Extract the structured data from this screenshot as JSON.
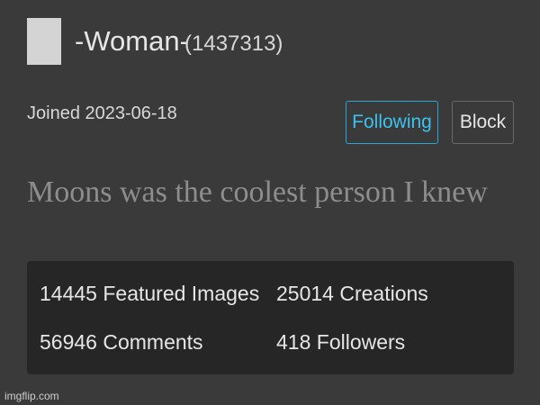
{
  "profile": {
    "username": "-Woman-",
    "user_id": "(1437313)",
    "joined": "Joined 2023-06-18",
    "bio": "Moons was the coolest person I knew"
  },
  "actions": {
    "following_label": "Following",
    "block_label": "Block"
  },
  "stats": {
    "featured_images": "14445 Featured Images",
    "creations": "25014 Creations",
    "comments": "56946 Comments",
    "followers": "418 Followers"
  },
  "watermark": "imgflip.com",
  "colors": {
    "background": "#3a3a3a",
    "stats_panel": "#262626",
    "accent": "#3cc2ee",
    "avatar_placeholder": "#d4d4d4"
  }
}
